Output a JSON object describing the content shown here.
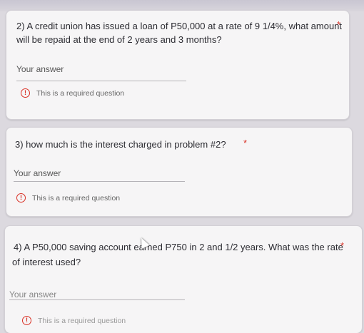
{
  "questions": [
    {
      "number_text": "2) A credit union has issued a loan of P50,000 at a rate of 9  1/4%, what amount",
      "text_line2": "will be repaid at the end of 2 years and 3 months?",
      "required_marker": "*",
      "answer_placeholder": "Your answer",
      "error_text": "This is a required question"
    },
    {
      "number_text": "3)  how much is the interest charged in problem #2?",
      "required_marker": "*",
      "answer_placeholder": "Your answer",
      "error_text": "This is a required question"
    },
    {
      "number_text": "4)  A P50,000 saving account earned P750 in 2 and 1/2 years.  What was the rate",
      "text_line2": "of interest used?",
      "required_marker": "*",
      "answer_placeholder": "Your answer",
      "error_text": "This is a required question"
    }
  ],
  "icons": {
    "error": "!"
  },
  "colors": {
    "required": "#d93025",
    "error_icon": "#d93025"
  }
}
